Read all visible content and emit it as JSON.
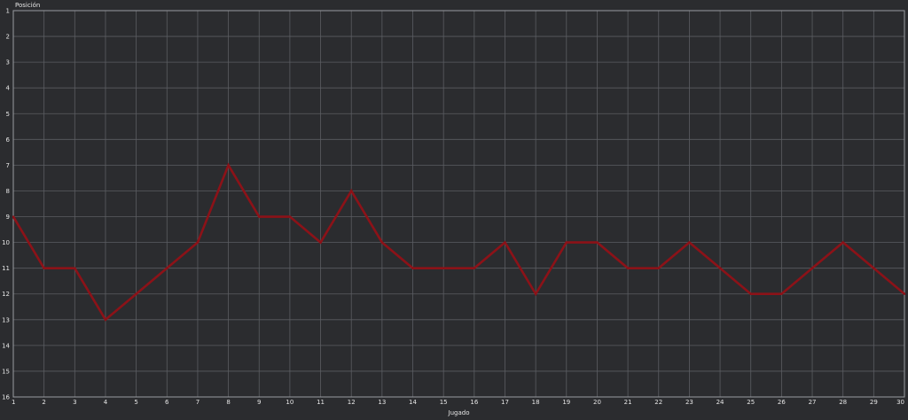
{
  "chart_data": {
    "type": "line",
    "title": "",
    "xlabel": "Jugado",
    "ylabel": "Posición",
    "x": [
      1,
      2,
      3,
      4,
      5,
      6,
      7,
      8,
      9,
      10,
      11,
      12,
      13,
      14,
      15,
      16,
      17,
      18,
      19,
      20,
      21,
      22,
      23,
      24,
      25,
      26,
      27,
      28,
      29,
      30
    ],
    "series": [
      {
        "values": [
          9,
          11,
          11,
          13,
          12,
          11,
          10,
          7,
          9,
          9,
          10,
          8,
          10,
          11,
          11,
          11,
          10,
          12,
          10,
          10,
          11,
          11,
          10,
          11,
          12,
          12,
          11,
          10,
          11,
          12
        ]
      }
    ],
    "xlim": [
      1,
      30
    ],
    "ylim": [
      1,
      16
    ],
    "y_inverted": true,
    "yticks": [
      1,
      2,
      3,
      4,
      5,
      6,
      7,
      8,
      9,
      10,
      11,
      12,
      13,
      14,
      15,
      16
    ],
    "xticks": [
      1,
      2,
      3,
      4,
      5,
      6,
      7,
      8,
      9,
      10,
      11,
      12,
      13,
      14,
      15,
      16,
      17,
      18,
      19,
      20,
      21,
      22,
      23,
      24,
      25,
      26,
      27,
      28,
      29,
      30
    ],
    "grid": true,
    "legend": "none",
    "colors": {
      "background": "#2b2c2f",
      "grid": "#5b5d62",
      "line": "#8c1218",
      "text": "#e6e6e6"
    }
  }
}
